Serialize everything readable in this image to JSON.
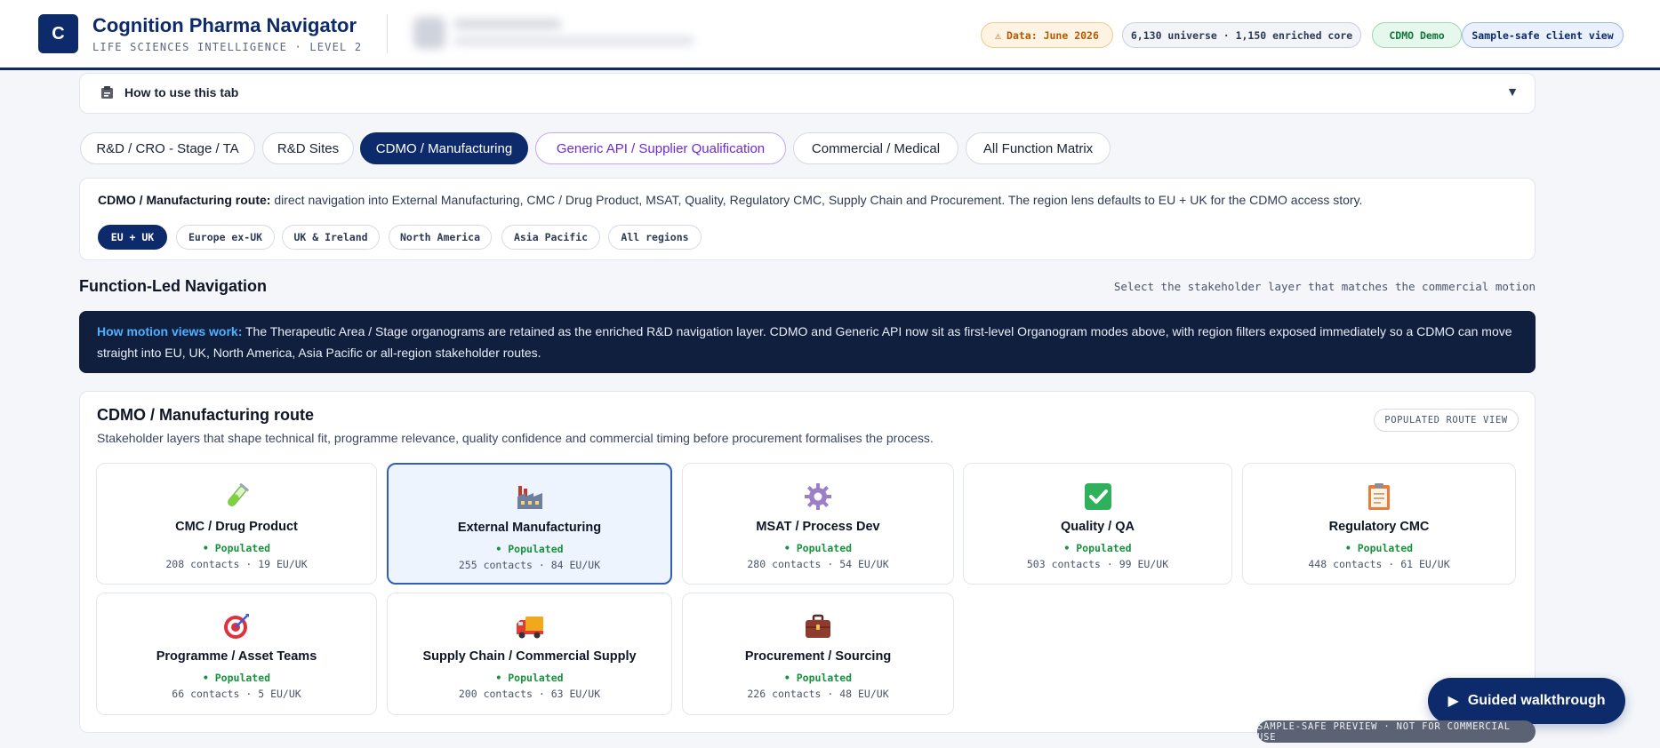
{
  "header": {
    "logo_letter": "C",
    "title": "Cognition Pharma Navigator",
    "subtitle": "LIFE SCIENCES INTELLIGENCE · LEVEL 2",
    "pills": {
      "data_date": "Data: June 2026",
      "universe": "6,130 universe · 1,150 enriched core",
      "demo": "CDMO Demo",
      "client_view": "Sample-safe client view"
    }
  },
  "howto": {
    "label": "How to use this tab",
    "icon": "clipboard-icon"
  },
  "tabs": [
    {
      "label": "R&D / CRO - Stage / TA"
    },
    {
      "label": "R&D Sites"
    },
    {
      "label": "CDMO / Manufacturing"
    },
    {
      "label": "Generic API / Supplier Qualification"
    },
    {
      "label": "Commercial / Medical"
    },
    {
      "label": "All Function Matrix"
    }
  ],
  "route": {
    "lead": "CDMO / Manufacturing route:",
    "text": " direct navigation into External Manufacturing, CMC / Drug Product, MSAT, Quality, Regulatory CMC, Supply Chain and Procurement. The region lens defaults to EU + UK for the CDMO access story.",
    "regions": [
      "EU + UK",
      "Europe ex-UK",
      "UK & Ireland",
      "North America",
      "Asia Pacific",
      "All regions"
    ]
  },
  "section": {
    "title": "Function-Led Navigation",
    "hint": "Select the stakeholder layer that matches the commercial motion"
  },
  "info": {
    "lead": "How motion views work:",
    "text": " The Therapeutic Area / Stage organograms are retained as the enriched R&D navigation layer. CDMO and Generic API now sit as first-level Organogram modes above, with region filters exposed immediately so a CDMO can move straight into EU, UK, North America, Asia Pacific or all-region stakeholder routes."
  },
  "main": {
    "title": "CDMO / Manufacturing route",
    "subtitle": "Stakeholder layers that shape technical fit, programme relevance, quality confidence and commercial timing before procurement formalises the process.",
    "badge": "POPULATED ROUTE VIEW",
    "cards": [
      {
        "name": "CMC / Drug Product",
        "status": "• Populated",
        "count": "208 contacts · 19 EU/UK",
        "icon": "test-tube-icon"
      },
      {
        "name": "External Manufacturing",
        "status": "• Populated",
        "count": "255 contacts · 84 EU/UK",
        "icon": "factory-icon"
      },
      {
        "name": "MSAT / Process Dev",
        "status": "• Populated",
        "count": "280 contacts · 54 EU/UK",
        "icon": "gear-icon"
      },
      {
        "name": "Quality / QA",
        "status": "• Populated",
        "count": "503 contacts · 99 EU/UK",
        "icon": "check-icon"
      },
      {
        "name": "Regulatory CMC",
        "status": "• Populated",
        "count": "448 contacts · 61 EU/UK",
        "icon": "clipboard-icon"
      },
      {
        "name": "Programme / Asset Teams",
        "status": "• Populated",
        "count": "66 contacts · 5 EU/UK",
        "icon": "target-icon"
      },
      {
        "name": "Supply Chain / Commercial Supply",
        "status": "• Populated",
        "count": "200 contacts · 63 EU/UK",
        "icon": "truck-icon"
      },
      {
        "name": "Procurement / Sourcing",
        "status": "• Populated",
        "count": "226 contacts · 48 EU/UK",
        "icon": "briefcase-icon"
      }
    ]
  },
  "floating": {
    "walkthrough": "Guided walkthrough",
    "watermark": "SAMPLE-SAFE PREVIEW · NOT FOR COMMERCIAL USE"
  },
  "colors": {
    "brand": "#0d2a6b",
    "accent_blue": "#4fb0ff",
    "populated": "#17913e",
    "purple_tab": "#6b2bd9"
  }
}
